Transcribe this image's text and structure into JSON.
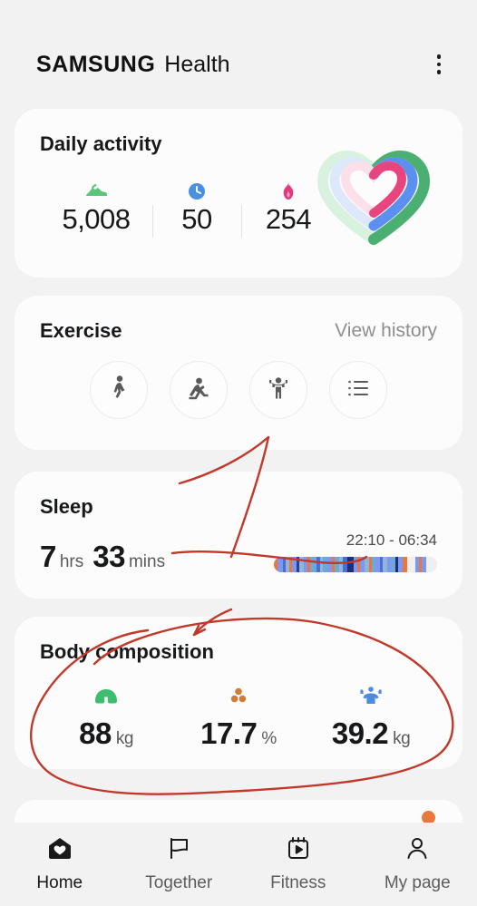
{
  "app": {
    "brand_first": "SAMSUNG",
    "brand_second": "Health",
    "menu_icon": "kebab-menu-icon"
  },
  "daily_activity": {
    "title": "Daily activity",
    "stats": [
      {
        "icon": "running-shoe-icon",
        "value": "5,008",
        "color": "#5bc47a"
      },
      {
        "icon": "clock-icon",
        "value": "50",
        "color": "#4a90e2"
      },
      {
        "icon": "flame-icon",
        "value": "254",
        "color": "#e0397e"
      }
    ],
    "ring_colors": {
      "outer": "#4caf72",
      "middle": "#5b8ff0",
      "inner": "#e8457f"
    }
  },
  "exercise": {
    "title": "Exercise",
    "view_history_label": "View history",
    "buttons": [
      {
        "icon": "walking-person-icon"
      },
      {
        "icon": "stretching-person-icon"
      },
      {
        "icon": "arms-raised-person-icon"
      },
      {
        "icon": "list-icon"
      }
    ]
  },
  "sleep": {
    "title": "Sleep",
    "hours": "7",
    "hours_unit": "hrs",
    "minutes": "33",
    "minutes_unit": "mins",
    "time_range": "22:10 - 06:34",
    "hypnogram": [
      {
        "w": 3,
        "c": "#e8783c"
      },
      {
        "w": 4,
        "c": "#7e97ef"
      },
      {
        "w": 2,
        "c": "#4a6fd0"
      },
      {
        "w": 3,
        "c": "#8fb4dd"
      },
      {
        "w": 2,
        "c": "#e8783c"
      },
      {
        "w": 4,
        "c": "#7e97ef"
      },
      {
        "w": 2,
        "c": "#2b3f8f"
      },
      {
        "w": 3,
        "c": "#8fb4dd"
      },
      {
        "w": 3,
        "c": "#7e97ef"
      },
      {
        "w": 2,
        "c": "#e8783c"
      },
      {
        "w": 5,
        "c": "#6fa8d6"
      },
      {
        "w": 3,
        "c": "#4a6fd0"
      },
      {
        "w": 2,
        "c": "#8fb4dd"
      },
      {
        "w": 4,
        "c": "#6fa8d6"
      },
      {
        "w": 3,
        "c": "#7e97ef"
      },
      {
        "w": 2,
        "c": "#e8783c"
      },
      {
        "w": 4,
        "c": "#6fa8d6"
      },
      {
        "w": 3,
        "c": "#8fb4dd"
      },
      {
        "w": 3,
        "c": "#4a6fd0"
      },
      {
        "w": 5,
        "c": "#1e2f7a"
      },
      {
        "w": 3,
        "c": "#7e97ef"
      },
      {
        "w": 2,
        "c": "#e8783c"
      },
      {
        "w": 4,
        "c": "#7e97ef"
      },
      {
        "w": 3,
        "c": "#8fb4dd"
      },
      {
        "w": 2,
        "c": "#e8783c"
      },
      {
        "w": 3,
        "c": "#6fa8d6"
      },
      {
        "w": 4,
        "c": "#7e97ef"
      },
      {
        "w": 2,
        "c": "#4a6fd0"
      },
      {
        "w": 3,
        "c": "#8fb4dd"
      },
      {
        "w": 3,
        "c": "#7e97ef"
      },
      {
        "w": 4,
        "c": "#6fa8d6"
      },
      {
        "w": 2,
        "c": "#1e2f7a"
      },
      {
        "w": 3,
        "c": "#7e97ef"
      },
      {
        "w": 4,
        "c": "#e8783c"
      },
      {
        "w": 6,
        "c": "#efefef"
      },
      {
        "w": 3,
        "c": "#7e97ef"
      },
      {
        "w": 2,
        "c": "#e8783c"
      },
      {
        "w": 4,
        "c": "#7e97ef"
      },
      {
        "w": 8,
        "c": "#efefef"
      }
    ]
  },
  "body_composition": {
    "title": "Body composition",
    "items": [
      {
        "icon": "weight-scale-icon",
        "color": "#3dbd6e",
        "value": "88",
        "unit": "kg"
      },
      {
        "icon": "body-fat-icon",
        "color": "#cd7e33",
        "value": "17.7",
        "unit": "%"
      },
      {
        "icon": "skeletal-muscle-icon",
        "color": "#4d8bdc",
        "value": "39.2",
        "unit": "kg"
      }
    ]
  },
  "peek_card": {
    "dot_icon": "notification-dot",
    "dot_color": "#e8783c"
  },
  "bottom_nav": {
    "items": [
      {
        "icon": "home-heart-icon",
        "label": "Home",
        "active": true
      },
      {
        "icon": "flag-icon",
        "label": "Together",
        "active": false
      },
      {
        "icon": "calendar-play-icon",
        "label": "Fitness",
        "active": false
      },
      {
        "icon": "person-icon",
        "label": "My page",
        "active": false
      }
    ]
  },
  "annotation": {
    "ink_color": "#c0392b",
    "marks": [
      "arrow-to-exercise-button",
      "circle-around-body-composition"
    ]
  }
}
